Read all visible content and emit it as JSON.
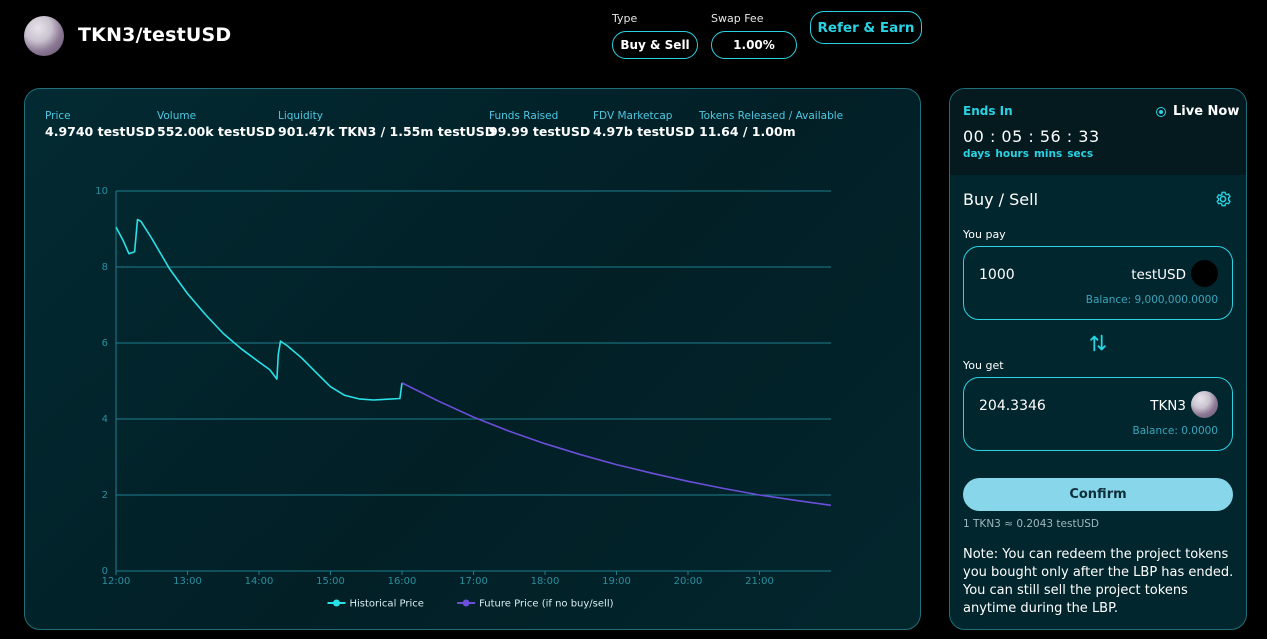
{
  "header": {
    "pair_title": "TKN3/testUSD",
    "type_label": "Type",
    "type_value": "Buy & Sell",
    "fee_label": "Swap Fee",
    "fee_value": "1.00%",
    "refer_label": "Refer & Earn"
  },
  "stats": [
    {
      "label": "Price",
      "value": "4.9740 testUSD"
    },
    {
      "label": "Volume",
      "value": "552.00k testUSD"
    },
    {
      "label": "Liquidity",
      "value": "901.47k TKN3 / 1.55m testUSD"
    },
    {
      "label": "Funds Raised",
      "value": "99.99 testUSD"
    },
    {
      "label": "FDV Marketcap",
      "value": "4.97b testUSD"
    },
    {
      "label": "Tokens Released / Available",
      "value": "11.64 / 1.00m"
    }
  ],
  "chart_data": {
    "type": "line",
    "title": "",
    "xlabel": "",
    "ylabel": "",
    "xlim": [
      12,
      22
    ],
    "ylim": [
      0,
      10
    ],
    "x_ticks": [
      "12:00",
      "13:00",
      "14:00",
      "15:00",
      "16:00",
      "17:00",
      "18:00",
      "19:00",
      "20:00",
      "21:00"
    ],
    "y_ticks": [
      "0",
      "2",
      "4",
      "6",
      "8",
      "10"
    ],
    "grid": true,
    "legend_position": "bottom-center",
    "series": [
      {
        "name": "Historical Price",
        "color": "#29e1e6",
        "points": [
          [
            12.0,
            9.05
          ],
          [
            12.1,
            8.7
          ],
          [
            12.18,
            8.35
          ],
          [
            12.26,
            8.4
          ],
          [
            12.3,
            9.25
          ],
          [
            12.35,
            9.2
          ],
          [
            12.5,
            8.75
          ],
          [
            12.75,
            7.95
          ],
          [
            13.0,
            7.3
          ],
          [
            13.25,
            6.75
          ],
          [
            13.5,
            6.25
          ],
          [
            13.75,
            5.85
          ],
          [
            14.0,
            5.5
          ],
          [
            14.15,
            5.3
          ],
          [
            14.25,
            5.05
          ],
          [
            14.27,
            5.7
          ],
          [
            14.3,
            6.05
          ],
          [
            14.4,
            5.92
          ],
          [
            14.6,
            5.6
          ],
          [
            14.8,
            5.22
          ],
          [
            15.0,
            4.85
          ],
          [
            15.2,
            4.62
          ],
          [
            15.4,
            4.53
          ],
          [
            15.6,
            4.5
          ],
          [
            15.8,
            4.52
          ],
          [
            15.97,
            4.54
          ],
          [
            16.0,
            4.95
          ]
        ]
      },
      {
        "name": "Future Price (if no buy/sell)",
        "color": "#6b4fd8",
        "points": [
          [
            16.0,
            4.95
          ],
          [
            16.5,
            4.48
          ],
          [
            17.0,
            4.05
          ],
          [
            17.5,
            3.68
          ],
          [
            18.0,
            3.35
          ],
          [
            18.5,
            3.06
          ],
          [
            19.0,
            2.8
          ],
          [
            19.5,
            2.57
          ],
          [
            20.0,
            2.36
          ],
          [
            20.5,
            2.17
          ],
          [
            21.0,
            2.0
          ],
          [
            21.5,
            1.86
          ],
          [
            22.0,
            1.73
          ]
        ]
      }
    ]
  },
  "sale": {
    "ends_label": "Ends In",
    "live_label": "Live Now",
    "timer": "00 : 05 : 56 : 33",
    "units": [
      "days",
      "hours",
      "mins",
      "secs"
    ]
  },
  "trade": {
    "title": "Buy / Sell",
    "pay_label": "You pay",
    "pay_amount": "1000",
    "pay_token": "testUSD",
    "pay_balance": "Balance: 9,000,000.0000",
    "get_label": "You get",
    "get_amount": "204.3346",
    "get_token": "TKN3",
    "get_balance": "Balance: 0.0000",
    "confirm_label": "Confirm",
    "rate": "1 TKN3 ≈ 0.2043 testUSD",
    "note": "Note: You can redeem the project tokens you bought only after the LBP has ended. You can still sell the project tokens anytime during the LBP."
  }
}
